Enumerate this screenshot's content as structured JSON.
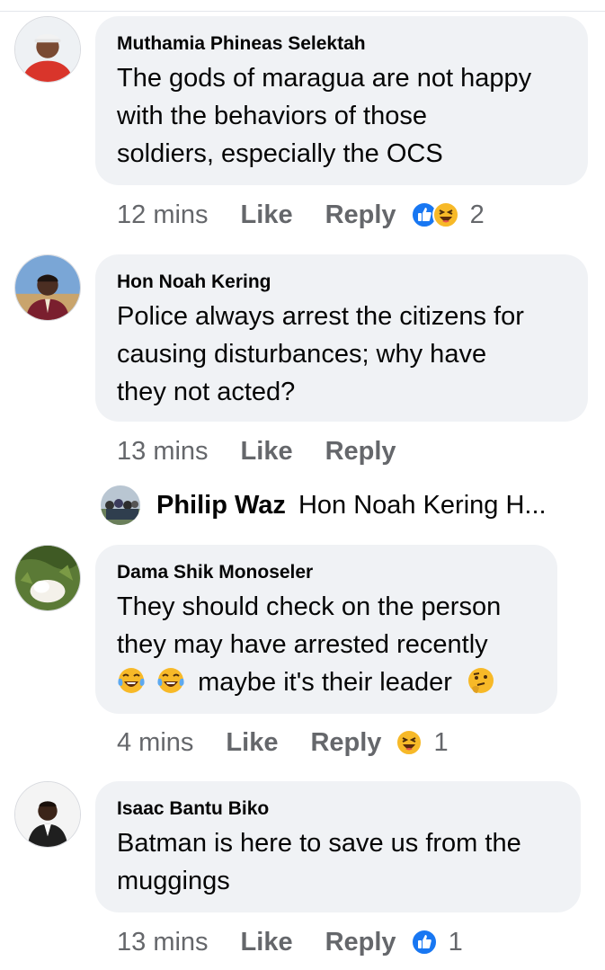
{
  "comments": [
    {
      "author": "Muthamia Phineas Selektah",
      "lines": [
        "The gods of maragua are not happy",
        "with the behaviors of those",
        "soldiers, especially the OCS"
      ],
      "time": "12 mins",
      "like_label": "Like",
      "reply_label": "Reply",
      "reactions": [
        "like-icon",
        "haha-icon"
      ],
      "reaction_count": "2"
    },
    {
      "author": "Hon Noah Kering",
      "lines": [
        "Police always arrest the citizens for",
        "causing disturbances; why have",
        "they not acted?"
      ],
      "time": "13 mins",
      "like_label": "Like",
      "reply_label": "Reply"
    },
    {
      "author": "Dama Shik Monoseler",
      "lines": [
        "They should check on the person",
        "they may have arrested recently",
        "maybe it's their leader"
      ],
      "time": "4 mins",
      "like_label": "Like",
      "reply_label": "Reply",
      "reactions": [
        "haha-icon"
      ],
      "reaction_count": "1"
    },
    {
      "author": "Isaac Bantu Biko",
      "lines": [
        "Batman is here to save us from the",
        "muggings"
      ],
      "time": "13 mins",
      "like_label": "Like",
      "reply_label": "Reply",
      "reactions": [
        "like-icon"
      ],
      "reaction_count": "1"
    }
  ],
  "reply_preview": {
    "author": "Philip Waz",
    "snippet": "Hon Noah Kering H..."
  },
  "colors": {
    "bubble": "#f0f2f5",
    "meta_text": "#65676b",
    "like_blue": "#1877f2",
    "haha_yellow": "#f7b928"
  }
}
